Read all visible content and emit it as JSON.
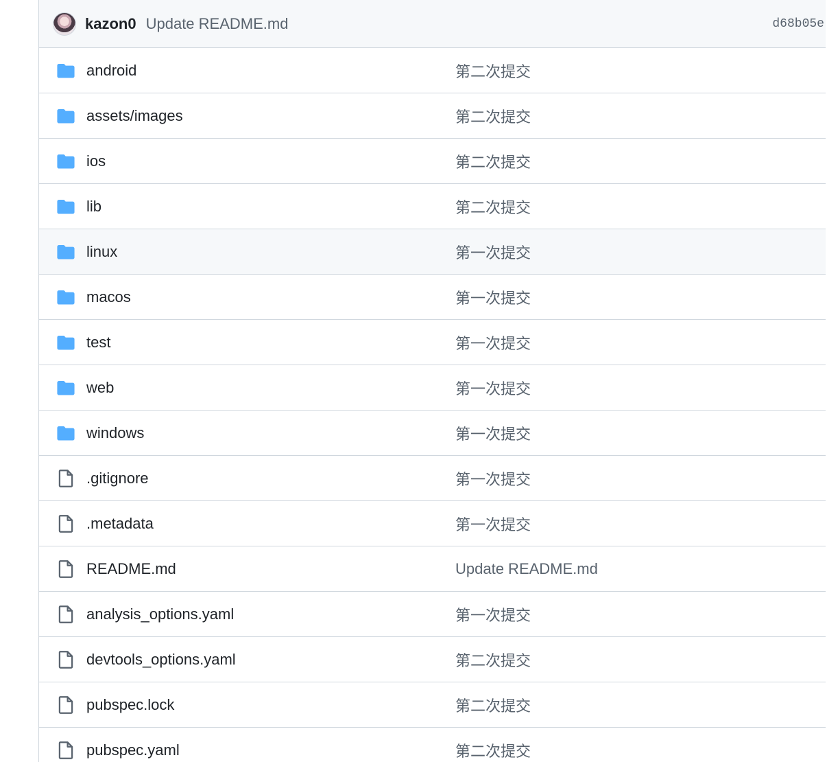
{
  "commit": {
    "author": "kazon0",
    "message": "Update README.md",
    "sha": "d68b05e",
    "avatar_icon": "user-avatar"
  },
  "colors": {
    "folder": "#54aeff",
    "file": "#59636e",
    "border": "#d0d7de",
    "header_bg": "#f6f8fa"
  },
  "files": [
    {
      "name": "android",
      "type": "folder",
      "message": "第二次提交"
    },
    {
      "name": "assets/images",
      "type": "folder",
      "message": "第二次提交"
    },
    {
      "name": "ios",
      "type": "folder",
      "message": "第二次提交"
    },
    {
      "name": "lib",
      "type": "folder",
      "message": "第二次提交"
    },
    {
      "name": "linux",
      "type": "folder",
      "message": "第一次提交"
    },
    {
      "name": "macos",
      "type": "folder",
      "message": "第一次提交"
    },
    {
      "name": "test",
      "type": "folder",
      "message": "第一次提交"
    },
    {
      "name": "web",
      "type": "folder",
      "message": "第一次提交"
    },
    {
      "name": "windows",
      "type": "folder",
      "message": "第一次提交"
    },
    {
      "name": ".gitignore",
      "type": "file",
      "message": "第一次提交"
    },
    {
      "name": ".metadata",
      "type": "file",
      "message": "第一次提交"
    },
    {
      "name": "README.md",
      "type": "file",
      "message": "Update README.md"
    },
    {
      "name": "analysis_options.yaml",
      "type": "file",
      "message": "第一次提交"
    },
    {
      "name": "devtools_options.yaml",
      "type": "file",
      "message": "第二次提交"
    },
    {
      "name": "pubspec.lock",
      "type": "file",
      "message": "第二次提交"
    },
    {
      "name": "pubspec.yaml",
      "type": "file",
      "message": "第二次提交"
    }
  ]
}
